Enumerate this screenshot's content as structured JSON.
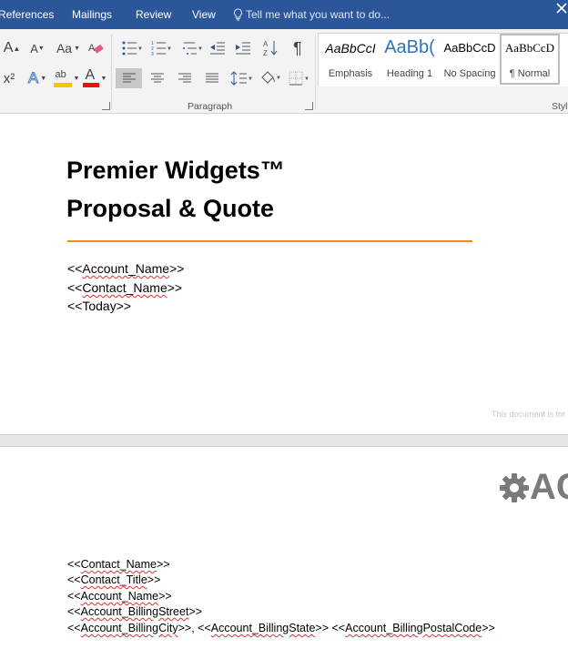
{
  "menubar": {
    "tabs": [
      "References",
      "Mailings",
      "Review",
      "View"
    ],
    "tell_me": "Tell me what you want to do..."
  },
  "ribbon": {
    "group_paragraph": "Paragraph",
    "group_styles": "Styl",
    "styles": [
      {
        "preview": "AaBbCcI",
        "name": "Emphasis"
      },
      {
        "preview": "AaBb(",
        "name": "Heading 1"
      },
      {
        "preview": "AaBbCcD",
        "name": "No Spacing"
      },
      {
        "preview": "AaBbCcD",
        "name": "¶ Normal"
      }
    ],
    "font_grow_label": "A",
    "font_shrink_label": "A",
    "change_case_label": "Aa",
    "superscript_label": "x²",
    "text_effect_label": "A",
    "font_color_label": "A",
    "highlight_label": "ab",
    "sort_label": "A↓Z",
    "pilcrow_label": "¶"
  },
  "document": {
    "title_line1": "Premier Widgets™",
    "title_line2": "Proposal & Quote",
    "fields_page1": [
      {
        "pre": "<<",
        "name": "Account_Name",
        "post": ">>"
      },
      {
        "pre": "<<",
        "name": "Contact_Name",
        "post": ">>"
      },
      {
        "pre": "<<",
        "name": "Today",
        "post": ">>"
      }
    ],
    "footer_note": "This document is for d",
    "logo_text": "AC",
    "fields_page2": [
      {
        "parts": [
          {
            "t": "<<"
          },
          {
            "t": "Contact_Name",
            "w": true
          },
          {
            "t": ">>"
          }
        ]
      },
      {
        "parts": [
          {
            "t": "<<"
          },
          {
            "t": "Contact_Title",
            "w": true
          },
          {
            "t": ">>"
          }
        ]
      },
      {
        "parts": [
          {
            "t": "<<"
          },
          {
            "t": "Account_Name",
            "w": true
          },
          {
            "t": ">>"
          }
        ]
      },
      {
        "parts": [
          {
            "t": "<<"
          },
          {
            "t": "Account_BillingStreet",
            "w": true
          },
          {
            "t": ">>"
          }
        ]
      },
      {
        "parts": [
          {
            "t": "<<"
          },
          {
            "t": "Account_BillingCity",
            "w": true
          },
          {
            "t": ">>, <<"
          },
          {
            "t": "Account_BillingState",
            "w": true
          },
          {
            "t": ">> <<"
          },
          {
            "t": "Account_BillingPostalCode",
            "w": true
          },
          {
            "t": ">>"
          }
        ]
      }
    ]
  },
  "colors": {
    "ribbon_blue": "#2b579a",
    "accent_rule": "#ed8c1a",
    "highlight_bar": "#f4c400",
    "font_color_bar": "#e81010"
  }
}
